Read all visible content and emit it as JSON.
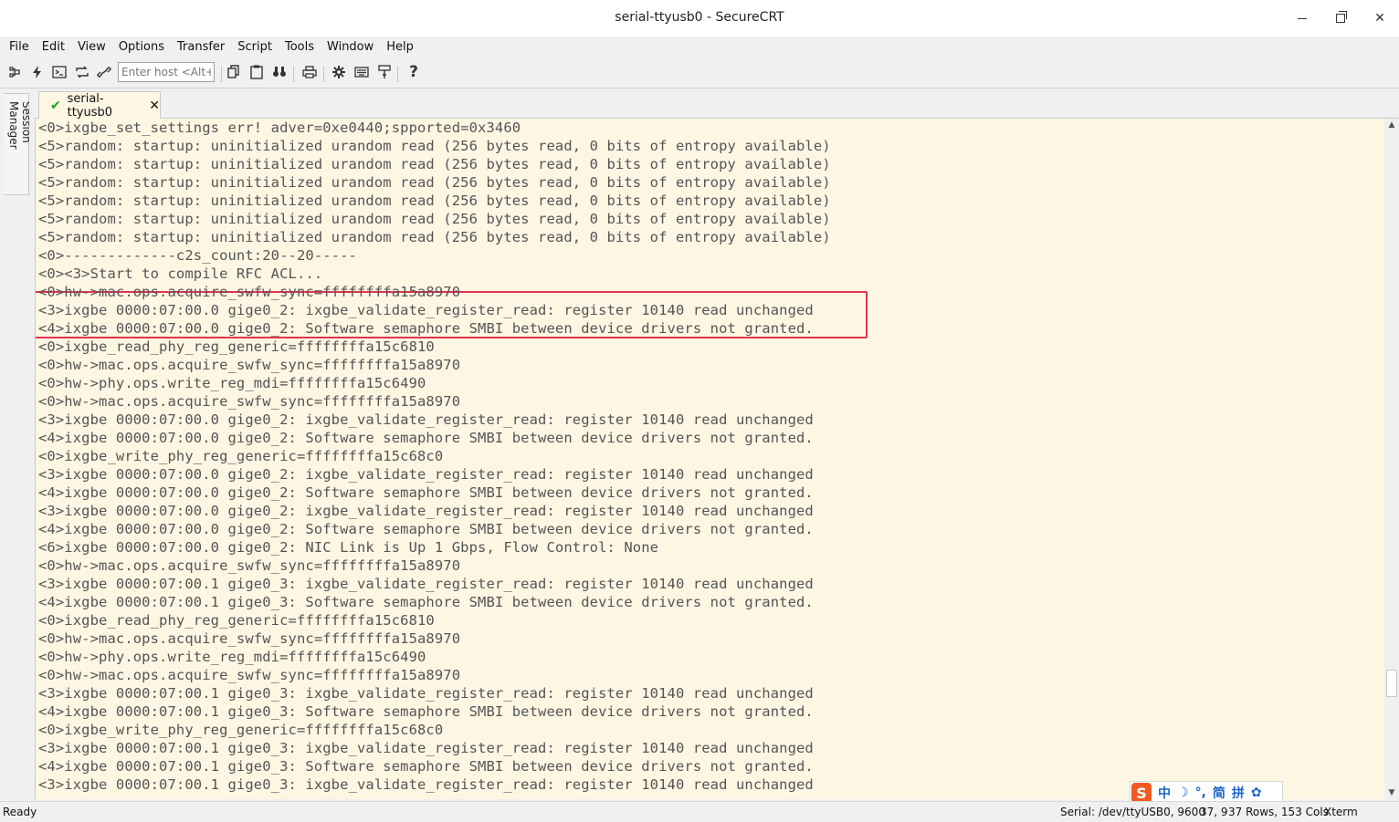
{
  "window": {
    "title": "serial-ttyusb0 - SecureCRT",
    "minimize_label": "─",
    "maximize_label": "",
    "close_label": "✕"
  },
  "menu": [
    "File",
    "Edit",
    "View",
    "Options",
    "Transfer",
    "Script",
    "Tools",
    "Window",
    "Help"
  ],
  "toolbar": {
    "host_placeholder": "Enter host <Alt+R>",
    "icons": [
      "connect-icon",
      "quick-connect-icon",
      "connect-in-tab-icon",
      "reconnect-icon",
      "disconnect-icon",
      "copy-icon",
      "paste-icon",
      "find-icon",
      "print-icon",
      "settings-icon",
      "keymap-icon",
      "sftp-icon",
      "help-icon"
    ]
  },
  "sidebar": {
    "session_manager_label": "Session Manager"
  },
  "tabs": [
    {
      "label": "serial-ttyusb0",
      "status": "connected",
      "status_color": "#1aa31a"
    }
  ],
  "terminal": {
    "background": "#fdf6e3",
    "text_color": "#555555",
    "highlight_color": "#e0344d",
    "lines": [
      "<0>ixgbe_set_settings err! adver=0xe0440;spported=0x3460",
      "<5>random: startup: uninitialized urandom read (256 bytes read, 0 bits of entropy available)",
      "<5>random: startup: uninitialized urandom read (256 bytes read, 0 bits of entropy available)",
      "<5>random: startup: uninitialized urandom read (256 bytes read, 0 bits of entropy available)",
      "<5>random: startup: uninitialized urandom read (256 bytes read, 0 bits of entropy available)",
      "<5>random: startup: uninitialized urandom read (256 bytes read, 0 bits of entropy available)",
      "<5>random: startup: uninitialized urandom read (256 bytes read, 0 bits of entropy available)",
      "<0>-------------c2s_count:20--20-----",
      "<0><3>Start to compile RFC ACL...",
      "<0>hw->mac.ops.acquire_swfw_sync=ffffffffa15a8970",
      "<3>ixgbe 0000:07:00.0 gige0_2: ixgbe_validate_register_read: register 10140 read unchanged",
      "<4>ixgbe 0000:07:00.0 gige0_2: Software semaphore SMBI between device drivers not granted.",
      "<0>ixgbe_read_phy_reg_generic=ffffffffa15c6810",
      "<0>hw->mac.ops.acquire_swfw_sync=ffffffffa15a8970",
      "<0>hw->phy.ops.write_reg_mdi=ffffffffa15c6490",
      "<0>hw->mac.ops.acquire_swfw_sync=ffffffffa15a8970",
      "<3>ixgbe 0000:07:00.0 gige0_2: ixgbe_validate_register_read: register 10140 read unchanged",
      "<4>ixgbe 0000:07:00.0 gige0_2: Software semaphore SMBI between device drivers not granted.",
      "<0>ixgbe_write_phy_reg_generic=ffffffffa15c68c0",
      "<3>ixgbe 0000:07:00.0 gige0_2: ixgbe_validate_register_read: register 10140 read unchanged",
      "<4>ixgbe 0000:07:00.0 gige0_2: Software semaphore SMBI between device drivers not granted.",
      "<3>ixgbe 0000:07:00.0 gige0_2: ixgbe_validate_register_read: register 10140 read unchanged",
      "<4>ixgbe 0000:07:00.0 gige0_2: Software semaphore SMBI between device drivers not granted.",
      "<6>ixgbe 0000:07:00.0 gige0_2: NIC Link is Up 1 Gbps, Flow Control: None",
      "<0>hw->mac.ops.acquire_swfw_sync=ffffffffa15a8970",
      "<3>ixgbe 0000:07:00.1 gige0_3: ixgbe_validate_register_read: register 10140 read unchanged",
      "<4>ixgbe 0000:07:00.1 gige0_3: Software semaphore SMBI between device drivers not granted.",
      "<0>ixgbe_read_phy_reg_generic=ffffffffa15c6810",
      "<0>hw->mac.ops.acquire_swfw_sync=ffffffffa15a8970",
      "<0>hw->phy.ops.write_reg_mdi=ffffffffa15c6490",
      "<0>hw->mac.ops.acquire_swfw_sync=ffffffffa15a8970",
      "<3>ixgbe 0000:07:00.1 gige0_3: ixgbe_validate_register_read: register 10140 read unchanged",
      "<4>ixgbe 0000:07:00.1 gige0_3: Software semaphore SMBI between device drivers not granted.",
      "<0>ixgbe_write_phy_reg_generic=ffffffffa15c68c0",
      "<3>ixgbe 0000:07:00.1 gige0_3: ixgbe_validate_register_read: register 10140 read unchanged",
      "<4>ixgbe 0000:07:00.1 gige0_3: Software semaphore SMBI between device drivers not granted.",
      "<3>ixgbe 0000:07:00.1 gige0_3: ixgbe_validate_register_read: register 10140 read unchanged"
    ]
  },
  "ime": {
    "logo": "S",
    "items": [
      "中",
      "☽",
      "°,",
      "简",
      "拼",
      "✿"
    ]
  },
  "status": {
    "ready": "Ready",
    "connection": "Serial: /dev/ttyUSB0, 9600",
    "cursor": "37, 9",
    "rows": "37 Rows, 153 Cols",
    "emulation": "Xterm"
  }
}
